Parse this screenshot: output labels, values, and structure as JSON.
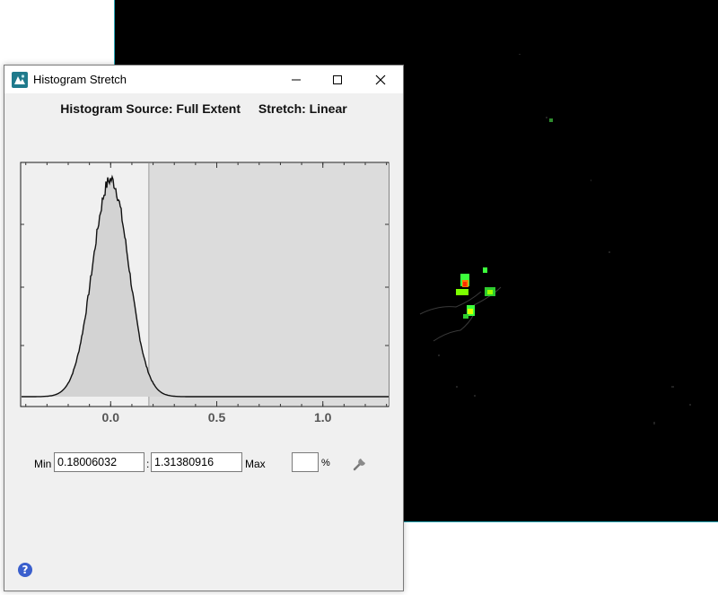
{
  "window": {
    "title": "Histogram Stretch"
  },
  "header": {
    "source_label": "Histogram Source: Full Extent",
    "stretch_label": "Stretch: Linear"
  },
  "chart_data": {
    "type": "area",
    "x_ticks": [
      "0.0",
      "0.5",
      "1.0"
    ],
    "xlim": [
      -0.42,
      1.31
    ],
    "distribution": {
      "mean": 0.0,
      "std": 0.085
    },
    "shaded_from": 0.18,
    "grid": false
  },
  "controls": {
    "min_label": "Min",
    "min_value": "0.18006032",
    "separator": ":",
    "max_value": "1.31380916",
    "max_label": "Max",
    "percent_value": "",
    "percent_label": "%"
  },
  "icons": {
    "app": "histogram-stretch-app-icon",
    "minimize": "minimize-icon",
    "maximize": "maximize-icon",
    "close": "close-icon",
    "settings": "wrench-icon",
    "help": "help-icon"
  },
  "help": {
    "glyph": "?"
  }
}
